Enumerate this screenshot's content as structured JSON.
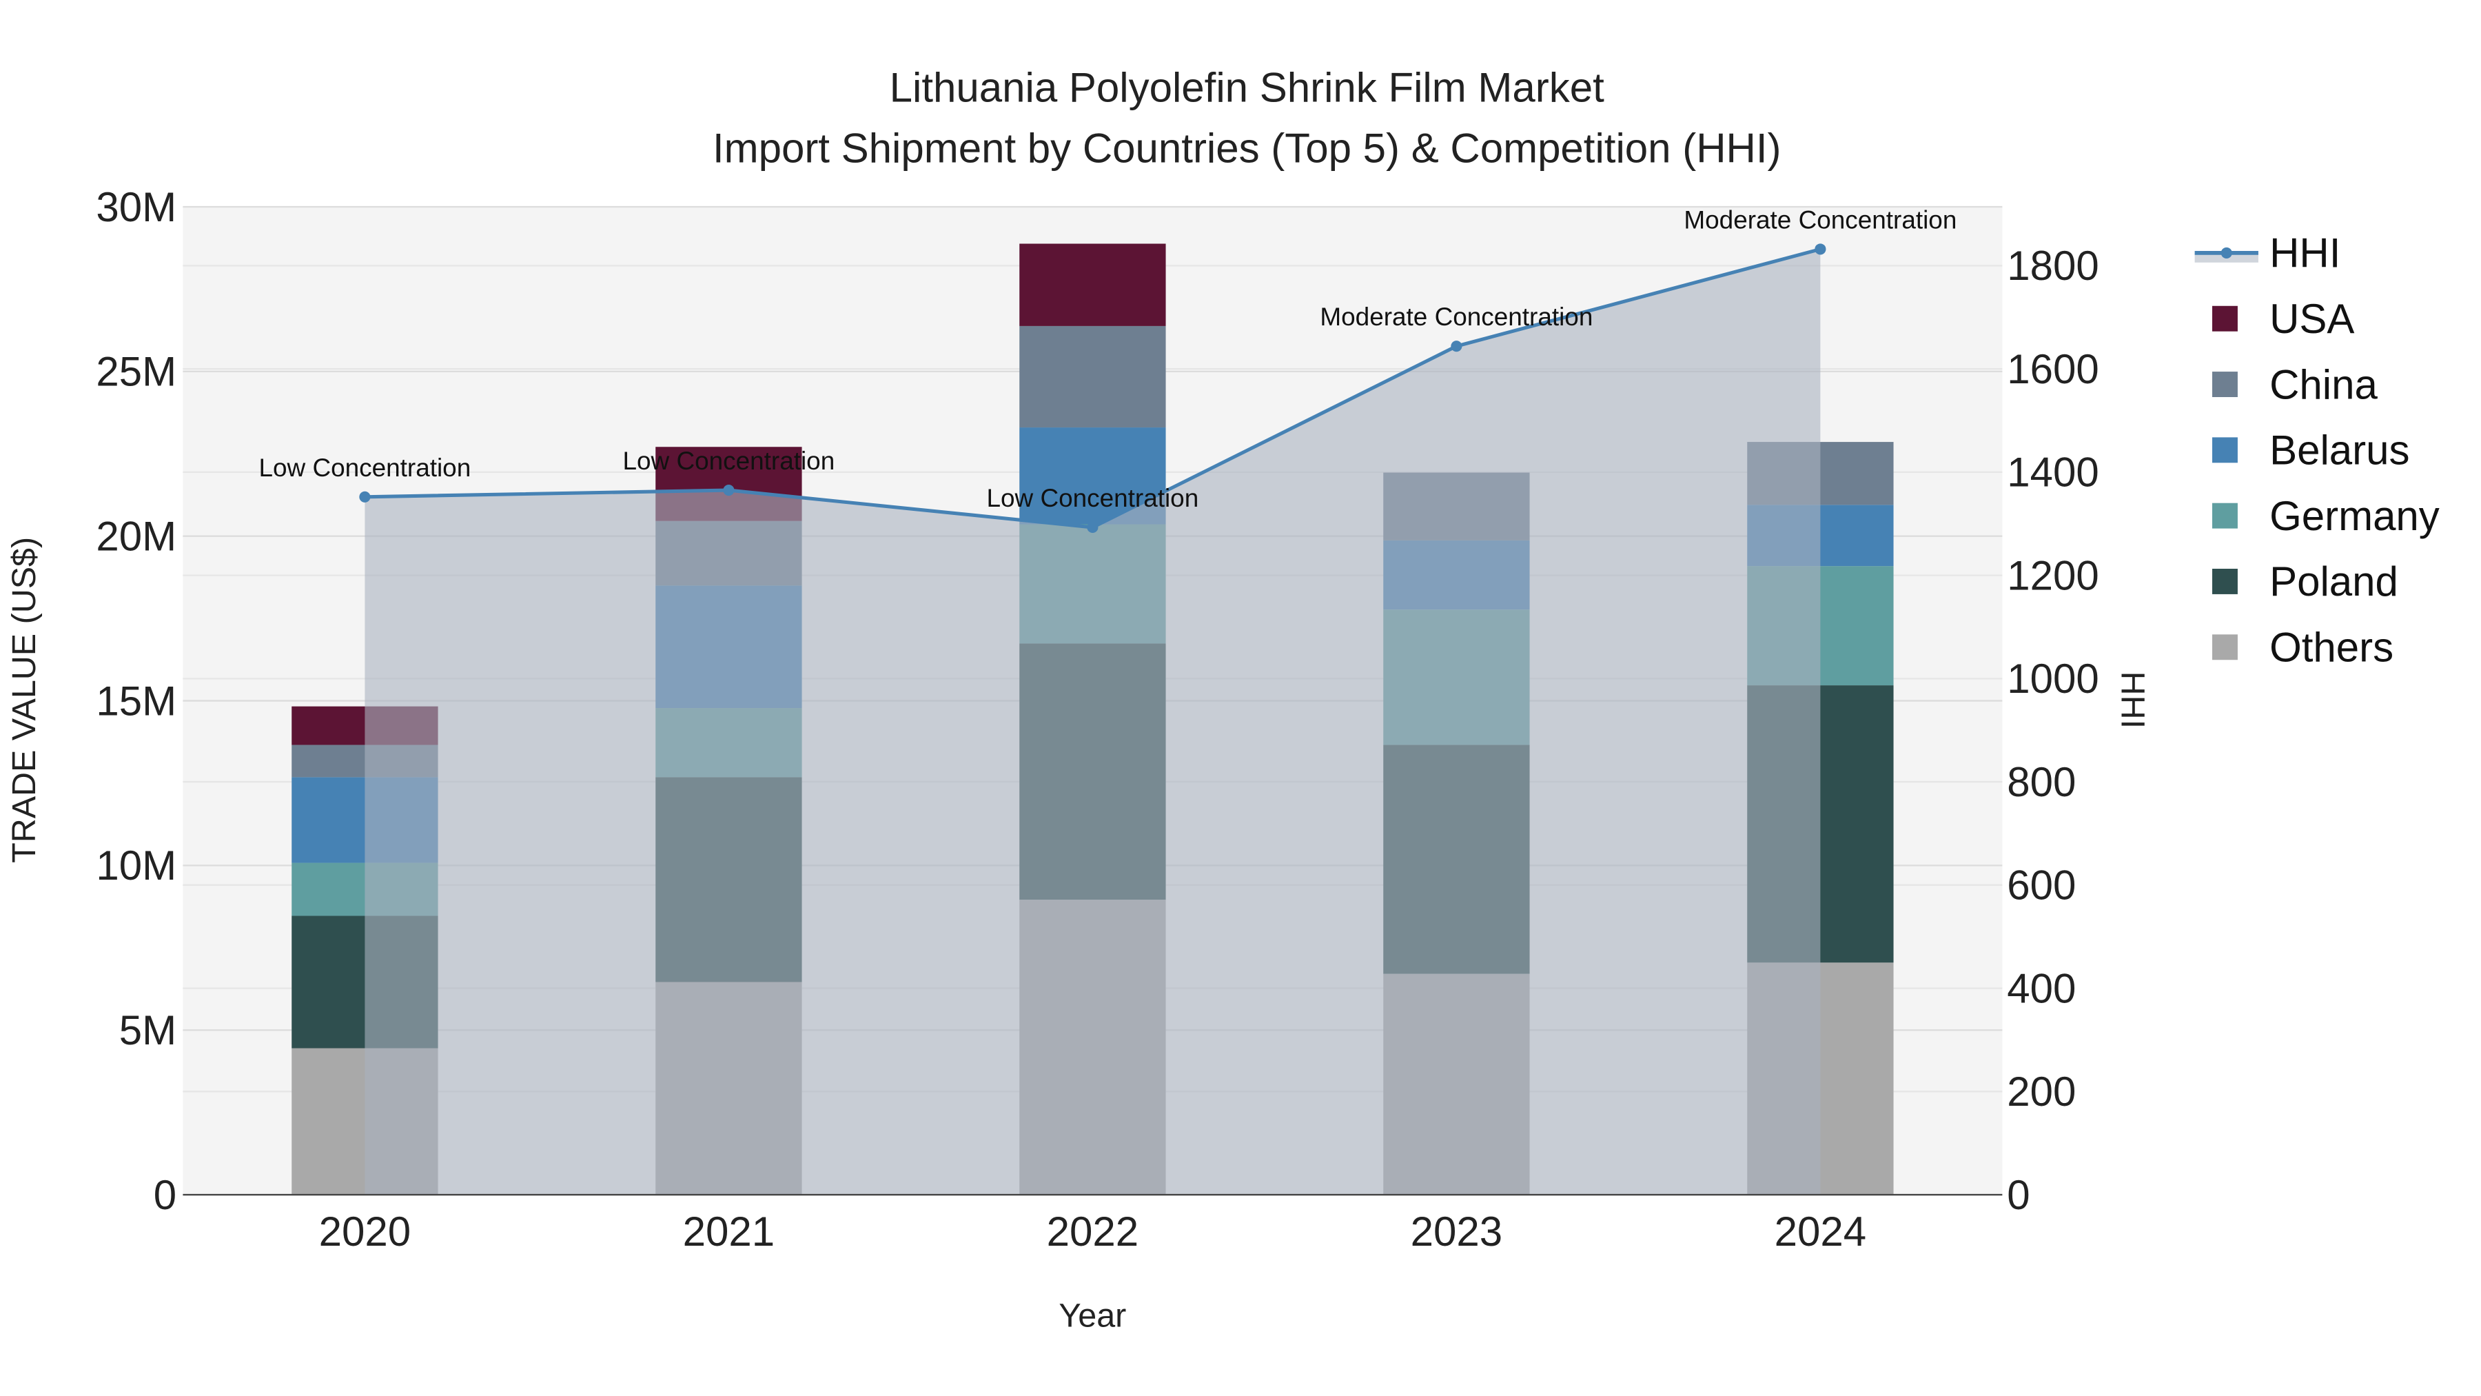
{
  "chart_data": {
    "type": "bar",
    "title_line1": "Lithuania Polyolefin Shrink Film Market",
    "title_line2": "Import Shipment by Countries (Top 5) & Competition (HHI)",
    "xlabel": "Year",
    "ylabel": "TRADE VALUE (US$)",
    "y2label": "HHI",
    "ylim": [
      0,
      30000000
    ],
    "y2lim": [
      0,
      1914
    ],
    "yticks": [
      {
        "v": 0,
        "label": "0"
      },
      {
        "v": 5000000,
        "label": "5M"
      },
      {
        "v": 10000000,
        "label": "10M"
      },
      {
        "v": 15000000,
        "label": "15M"
      },
      {
        "v": 20000000,
        "label": "20M"
      },
      {
        "v": 25000000,
        "label": "25M"
      },
      {
        "v": 30000000,
        "label": "30M"
      }
    ],
    "y2ticks": [
      {
        "v": 0,
        "label": "0"
      },
      {
        "v": 200,
        "label": "200"
      },
      {
        "v": 400,
        "label": "400"
      },
      {
        "v": 600,
        "label": "600"
      },
      {
        "v": 800,
        "label": "800"
      },
      {
        "v": 1000,
        "label": "1000"
      },
      {
        "v": 1200,
        "label": "1200"
      },
      {
        "v": 1400,
        "label": "1400"
      },
      {
        "v": 1600,
        "label": "1600"
      },
      {
        "v": 1800,
        "label": "1800"
      }
    ],
    "categories": [
      "2020",
      "2021",
      "2022",
      "2023",
      "2024"
    ],
    "series": [
      {
        "name": "Others",
        "color": "#a9a9a9",
        "values": [
          4450000,
          6460000,
          8960000,
          6710000,
          7050000
        ]
      },
      {
        "name": "Poland",
        "color": "#2f4f4f",
        "values": [
          4020000,
          6220000,
          7780000,
          6950000,
          8420000
        ]
      },
      {
        "name": "Germany",
        "color": "#5f9ea0",
        "values": [
          1610000,
          2100000,
          3620000,
          4110000,
          3620000
        ]
      },
      {
        "name": "Belarus",
        "color": "#4682b4",
        "values": [
          2600000,
          3720000,
          2940000,
          2100000,
          1860000
        ]
      },
      {
        "name": "China",
        "color": "#6e7f91",
        "values": [
          980000,
          1960000,
          3080000,
          2060000,
          1910000
        ]
      },
      {
        "name": "USA",
        "color": "#5c1434",
        "values": [
          1170000,
          2250000,
          2500000,
          0,
          0
        ]
      }
    ],
    "hhi": {
      "name": "HHI",
      "color": "#4682b4",
      "values": [
        1352,
        1365,
        1293,
        1644,
        1832
      ],
      "annotations": [
        "Low Concentration",
        "Low Concentration",
        "Low Concentration",
        "Moderate Concentration",
        "Moderate Concentration"
      ]
    },
    "legend": [
      "HHI",
      "USA",
      "China",
      "Belarus",
      "Germany",
      "Poland",
      "Others"
    ],
    "legend_placement": "right",
    "grid": true
  }
}
